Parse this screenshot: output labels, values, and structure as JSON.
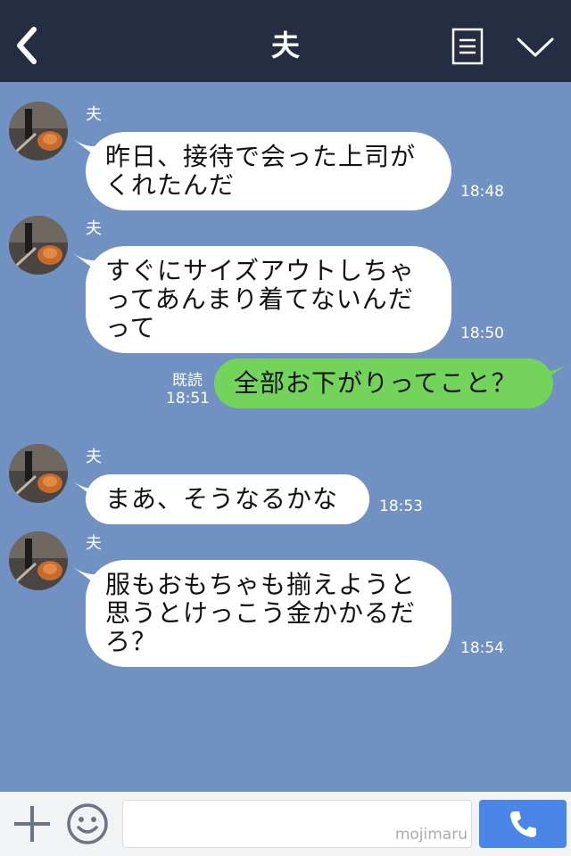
{
  "header": {
    "title": "夫",
    "back_icon": "chevron-left-icon",
    "notes_icon": "notes-icon",
    "menu_icon": "chevron-down-icon"
  },
  "messages": [
    {
      "side": "in",
      "sender": "夫",
      "lines": [
        "昨日、接待で会った上司が",
        "くれたんだ"
      ],
      "time": "18:48"
    },
    {
      "side": "in",
      "sender": "夫",
      "lines": [
        "すぐにサイズアウトしちゃ",
        "ってあんまり着てないんだ",
        "って"
      ],
      "time": "18:50"
    },
    {
      "side": "out",
      "read": "既読",
      "lines": [
        "全部お下がりってこと？"
      ],
      "time": "18:51"
    },
    {
      "side": "in",
      "sender": "夫",
      "lines": [
        "まあ、そうなるかな"
      ],
      "time": "18:53"
    },
    {
      "side": "in",
      "sender": "夫",
      "lines": [
        "服もおもちゃも揃えようと",
        "思うとけっこう金かかるだ",
        "ろ？"
      ],
      "time": "18:54"
    }
  ],
  "input_bar": {
    "plus_icon": "plus-icon",
    "emoji_icon": "smiley-icon",
    "message_value": "",
    "watermark": "mojimaru",
    "call_icon": "phone-icon"
  },
  "colors": {
    "header_bg": "#252d42",
    "chat_bg": "#7191c2",
    "incoming_bubble": "#ffffff",
    "outgoing_bubble": "#74d35a",
    "call_button": "#4a86e8"
  }
}
